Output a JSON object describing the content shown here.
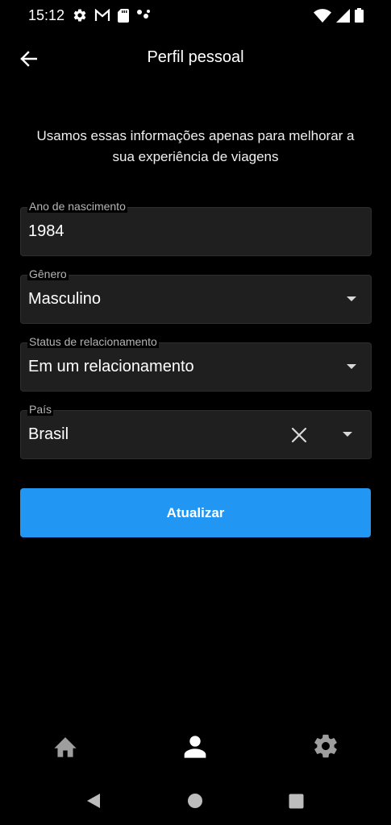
{
  "status_bar": {
    "time": "15:12",
    "left_icons": [
      "gear-icon",
      "gmail-icon",
      "sd-card-icon",
      "dots-icon"
    ],
    "right_icons": [
      "wifi-icon",
      "signal-icon",
      "battery-icon"
    ]
  },
  "app_bar": {
    "title": "Perfil pessoal",
    "back_icon": "arrow-left-icon"
  },
  "intro_text": "Usamos essas informações apenas para melhorar a sua experiência de viagens",
  "form": {
    "birth_year": {
      "label": "Ano de nascimento",
      "value": "1984"
    },
    "gender": {
      "label": "Gênero",
      "value": "Masculino"
    },
    "relationship": {
      "label": "Status de relacionamento",
      "value": "Em um relacionamento"
    },
    "country": {
      "label": "País",
      "value": "Brasil"
    }
  },
  "update_button": {
    "label": "Atualizar"
  },
  "colors": {
    "background": "#000000",
    "field_background": "#1f1f1f",
    "accent": "#2196f3",
    "nav_inactive": "#9e9e9e",
    "nav_active": "#ffffff"
  },
  "bottom_nav": {
    "items": [
      {
        "icon": "home-icon",
        "active": false
      },
      {
        "icon": "person-icon",
        "active": true
      },
      {
        "icon": "settings-icon",
        "active": false
      }
    ]
  },
  "system_nav": {
    "buttons": [
      "back-triangle-icon",
      "home-circle-icon",
      "recents-square-icon"
    ]
  }
}
